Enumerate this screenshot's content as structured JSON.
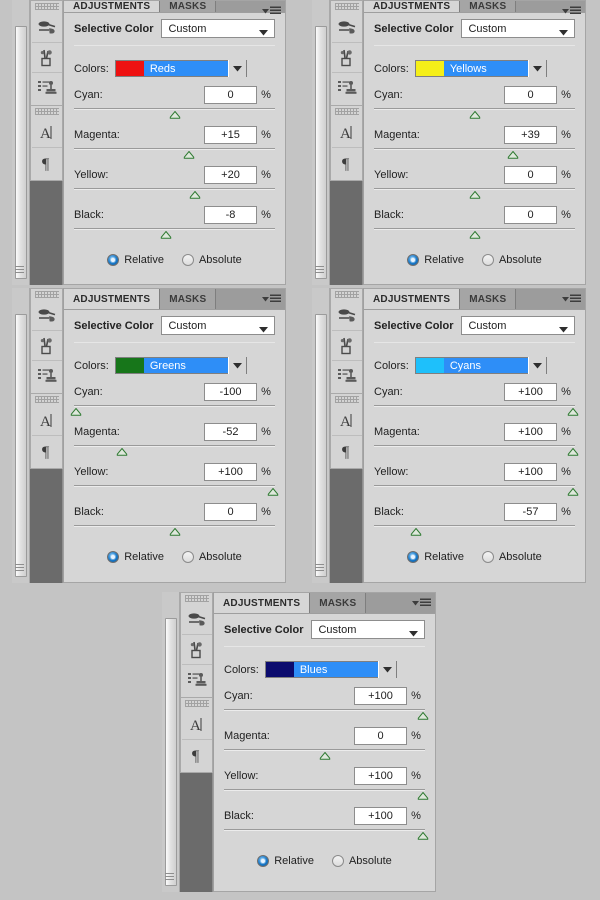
{
  "app": {
    "tabs": {
      "adjustments": "ADJUSTMENTS",
      "masks": "MASKS"
    },
    "panel_title": "Selective Color",
    "preset_value": "Custom",
    "colors_label": "Colors:",
    "percent_symbol": "%",
    "method": {
      "relative": "Relative",
      "absolute": "Absolute"
    },
    "channel_labels": {
      "cyan": "Cyan:",
      "magenta": "Magenta:",
      "yellow": "Yellow:",
      "black": "Black:"
    },
    "dock_icons": [
      "brush-tool-icon",
      "brush-holder-icon",
      "clone-stamp-icon",
      "type-tool-icon",
      "paragraph-icon"
    ],
    "menu_icon": "panel-menu-icon",
    "colors_blue_highlight": "#2e8ef7"
  },
  "panels": [
    {
      "id": "reds",
      "color_name": "Reds",
      "swatch": "#ee1111",
      "method_selected": "Relative",
      "channels": [
        {
          "key": "cyan",
          "label": "Cyan:",
          "value": "0",
          "pos": 50
        },
        {
          "key": "magenta",
          "label": "Magenta:",
          "value": "+15",
          "pos": 57
        },
        {
          "key": "yellow",
          "label": "Yellow:",
          "value": "+20",
          "pos": 60
        },
        {
          "key": "black",
          "label": "Black:",
          "value": "-8",
          "pos": 46
        }
      ]
    },
    {
      "id": "yellows",
      "color_name": "Yellows",
      "swatch": "#f5ef18",
      "method_selected": "Relative",
      "channels": [
        {
          "key": "cyan",
          "label": "Cyan:",
          "value": "0",
          "pos": 50
        },
        {
          "key": "magenta",
          "label": "Magenta:",
          "value": "+39",
          "pos": 69
        },
        {
          "key": "yellow",
          "label": "Yellow:",
          "value": "0",
          "pos": 50
        },
        {
          "key": "black",
          "label": "Black:",
          "value": "0",
          "pos": 50
        }
      ]
    },
    {
      "id": "greens",
      "color_name": "Greens",
      "swatch": "#17761a",
      "method_selected": "Relative",
      "channels": [
        {
          "key": "cyan",
          "label": "Cyan:",
          "value": "-100",
          "pos": 1
        },
        {
          "key": "magenta",
          "label": "Magenta:",
          "value": "-52",
          "pos": 24
        },
        {
          "key": "yellow",
          "label": "Yellow:",
          "value": "+100",
          "pos": 99
        },
        {
          "key": "black",
          "label": "Black:",
          "value": "0",
          "pos": 50
        }
      ]
    },
    {
      "id": "cyans",
      "color_name": "Cyans",
      "swatch": "#1ec0fb",
      "method_selected": "Relative",
      "channels": [
        {
          "key": "cyan",
          "label": "Cyan:",
          "value": "+100",
          "pos": 99
        },
        {
          "key": "magenta",
          "label": "Magenta:",
          "value": "+100",
          "pos": 99
        },
        {
          "key": "yellow",
          "label": "Yellow:",
          "value": "+100",
          "pos": 99
        },
        {
          "key": "black",
          "label": "Black:",
          "value": "-57",
          "pos": 21
        }
      ]
    },
    {
      "id": "blues",
      "color_name": "Blues",
      "swatch": "#0b0b6e",
      "method_selected": "Relative",
      "channels": [
        {
          "key": "cyan",
          "label": "Cyan:",
          "value": "+100",
          "pos": 99
        },
        {
          "key": "magenta",
          "label": "Magenta:",
          "value": "0",
          "pos": 50
        },
        {
          "key": "yellow",
          "label": "Yellow:",
          "value": "+100",
          "pos": 99
        },
        {
          "key": "black",
          "label": "Black:",
          "value": "+100",
          "pos": 99
        }
      ]
    }
  ]
}
